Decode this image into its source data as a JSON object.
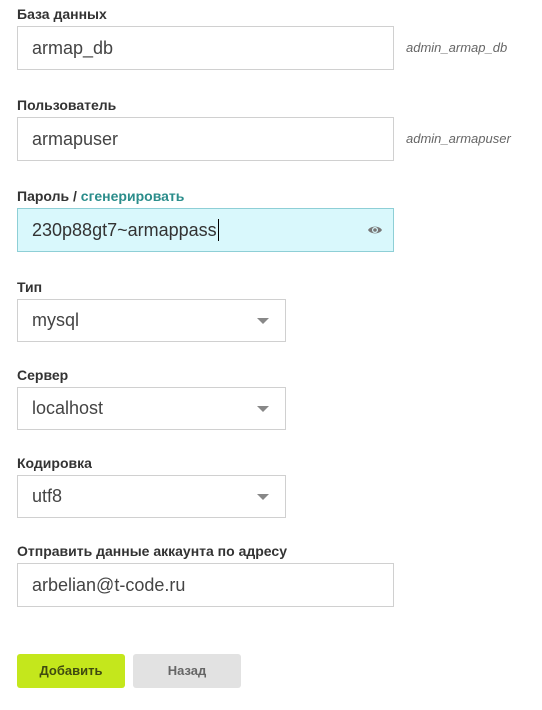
{
  "database": {
    "label": "База данных",
    "value": "armap_db",
    "hint": "admin_armap_db"
  },
  "user": {
    "label": "Пользователь",
    "value": "armapuser",
    "hint": "admin_armapuser"
  },
  "password": {
    "label": "Пароль",
    "separator": "/",
    "generate_link": "сгенерировать",
    "value": "230p88gt7~armappass",
    "icon": "eye-icon"
  },
  "type": {
    "label": "Тип",
    "value": "mysql"
  },
  "server": {
    "label": "Сервер",
    "value": "localhost"
  },
  "encoding": {
    "label": "Кодировка",
    "value": "utf8"
  },
  "email": {
    "label": "Отправить данные аккаунта по адресу",
    "value": "arbelian@t-code.ru"
  },
  "buttons": {
    "add_label": "Добавить",
    "back_label": "Назад"
  },
  "colors": {
    "accent_link": "#2b8d8b",
    "primary_button": "#c4e71c",
    "active_field": "#d9f8fc"
  }
}
